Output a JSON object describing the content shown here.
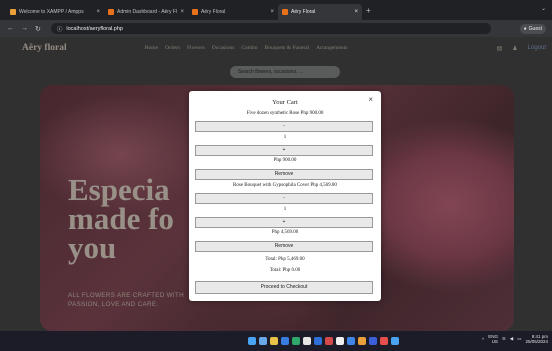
{
  "browser": {
    "tabs": [
      {
        "title": "Welcome to XAMPP / Ampps",
        "favicon_color": "#e9a03b",
        "active": false
      },
      {
        "title": "Admin Dashboard - Aëry Floral",
        "favicon_color": "#e8711b",
        "active": false
      },
      {
        "title": "Aëry Floral",
        "favicon_color": "#e8711b",
        "active": false
      },
      {
        "title": "Aëry Floral",
        "favicon_color": "#e8711b",
        "active": true
      }
    ],
    "new_tab": "+",
    "tab_overflow": "⌄",
    "url": "localhost/aeryfloral.php",
    "profile_label": "Guest"
  },
  "navbar": {
    "brand": "Aëry floral",
    "menu": [
      "Home",
      "Orders",
      "Flowers",
      "Occasions",
      "Combo",
      "Bouquets & Funeral",
      "Arrangements"
    ],
    "login_label": "Logout"
  },
  "search": {
    "value": "Search flowers, occasions, ..."
  },
  "hero": {
    "heading_lines": [
      "Especia",
      "made fo",
      "you"
    ],
    "subtext_lines": [
      "ALL FLOWERS ARE CRAFTED WITH",
      "PASSION, LOVE AND CARE."
    ]
  },
  "cart": {
    "title": "Your Cart",
    "close": "×",
    "items": [
      {
        "label": "Five dozen synthetic Rose Php 900.00",
        "minus": "-",
        "qty": "1",
        "plus": "+",
        "subtotal": "Php 900.00",
        "remove": "Remove"
      },
      {
        "label": "Rose Bouquet with Gypsophila Cover Php 4,569.00",
        "minus": "-",
        "qty": "1",
        "plus": "+",
        "subtotal": "Php 4,569.00",
        "remove": "Remove"
      }
    ],
    "total": "Total: Php 5,469.00",
    "total_secondary": "Total: Php 0.00",
    "checkout": "Proceed to Checkout"
  },
  "taskbar": {
    "icon_colors": [
      "#4aa3f0",
      "#6aa9e9",
      "#e9c248",
      "#3a7be0",
      "#2fa86b",
      "#e6e6e6",
      "#2e6fd8",
      "#d44a4a",
      "#f0f0f0",
      "#3f86e8",
      "#e9a03b",
      "#3b5fd8",
      "#e94e4e",
      "#4aa3f0"
    ],
    "lang": "ENG",
    "region": "US",
    "time": "9:41 pm",
    "date": "25/05/2024"
  }
}
